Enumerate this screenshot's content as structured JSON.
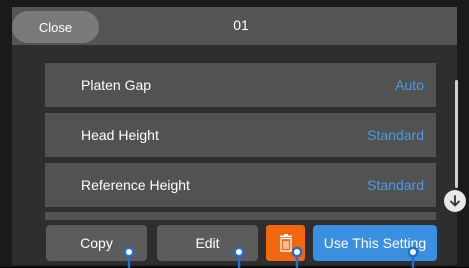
{
  "header": {
    "close_label": "Close",
    "title": "01"
  },
  "settings": [
    {
      "label": "Platen Gap",
      "value": "Auto"
    },
    {
      "label": "Head Height",
      "value": "Standard"
    },
    {
      "label": "Reference Height",
      "value": "Standard"
    }
  ],
  "footer": {
    "copy_label": "Copy",
    "edit_label": "Edit",
    "delete_icon": "trash-icon",
    "use_label": "Use This Setting"
  },
  "icons": {
    "scroll_down": "arrow-down-circle-icon",
    "touch_marker": "touch-pin-icon"
  },
  "colors": {
    "accent": "#3a8fe0",
    "value_text": "#4a9be6",
    "delete": "#f0670f",
    "marker": "#1e6fd0"
  }
}
